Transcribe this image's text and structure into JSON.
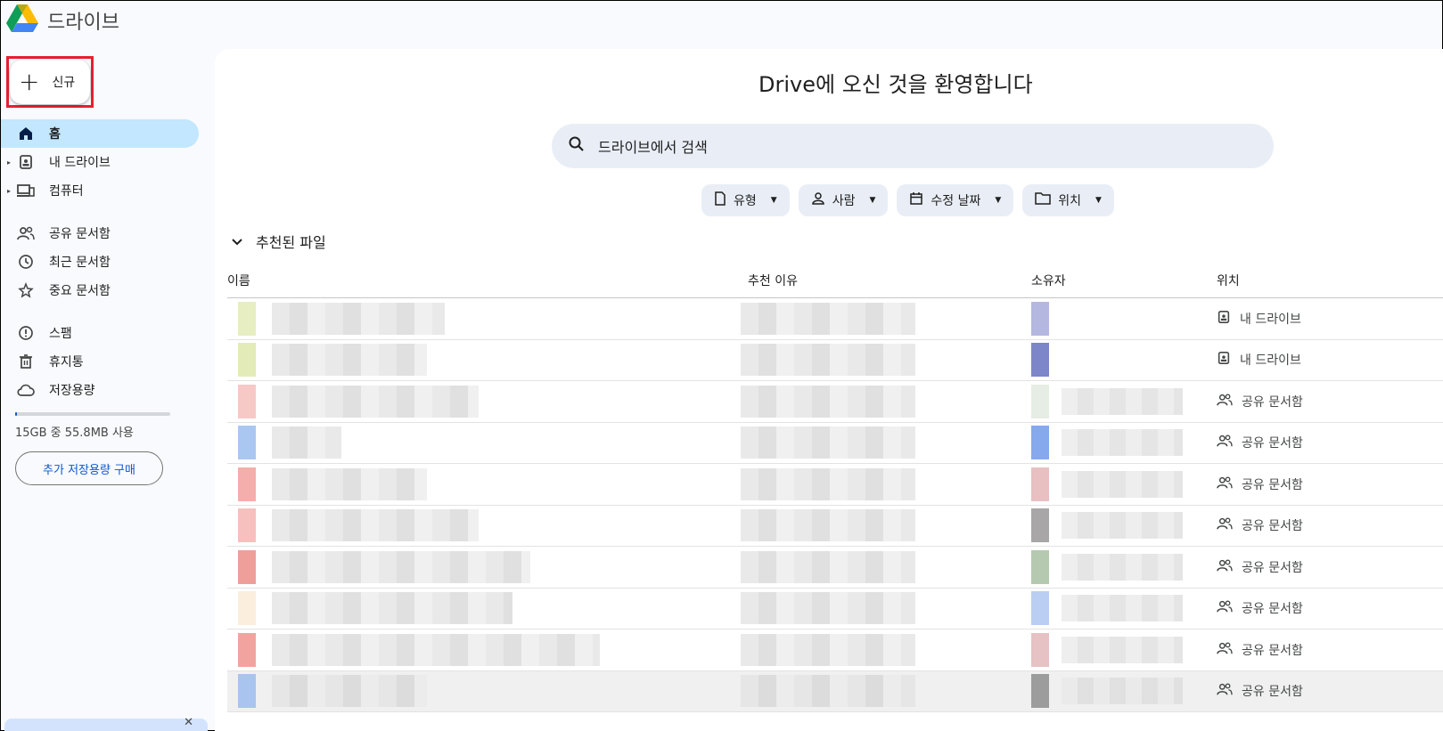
{
  "app": {
    "title": "드라이브"
  },
  "new_button": {
    "label": "신규"
  },
  "nav": {
    "items": [
      {
        "label": "홈",
        "icon": "home-icon"
      },
      {
        "label": "내 드라이브",
        "icon": "my-drive-icon"
      },
      {
        "label": "컴퓨터",
        "icon": "computers-icon"
      },
      {
        "label": "공유 문서함",
        "icon": "shared-icon"
      },
      {
        "label": "최근 문서함",
        "icon": "clock-icon"
      },
      {
        "label": "중요 문서함",
        "icon": "star-icon"
      },
      {
        "label": "스팸",
        "icon": "spam-icon"
      },
      {
        "label": "휴지통",
        "icon": "trash-icon"
      },
      {
        "label": "저장용량",
        "icon": "cloud-icon"
      }
    ]
  },
  "storage": {
    "text": "15GB 중 55.8MB 사용",
    "used_fraction": 0.0036,
    "buy_label": "추가 저장용량 구매"
  },
  "main": {
    "welcome": "Drive에 오신 것을 환영합니다",
    "search_placeholder": "드라이브에서 검색",
    "filters": [
      "유형",
      "사람",
      "수정 날짜",
      "위치"
    ],
    "section_title": "추천된 파일",
    "columns": {
      "name": "이름",
      "reason": "추천 이유",
      "owner": "소유자",
      "location": "위치"
    },
    "rows": [
      {
        "location": "내 드라이브"
      },
      {
        "location": "내 드라이브"
      },
      {
        "location": "공유 문서함"
      },
      {
        "location": "공유 문서함"
      },
      {
        "location": "공유 문서함"
      },
      {
        "location": "공유 문서함"
      },
      {
        "location": "공유 문서함"
      },
      {
        "location": "공유 문서함"
      },
      {
        "location": "공유 문서함"
      },
      {
        "location": "공유 문서함"
      }
    ]
  },
  "colors": {
    "accent": "#0b57d0",
    "active_nav": "#c2e7ff",
    "highlight_border": "#e5202e"
  }
}
